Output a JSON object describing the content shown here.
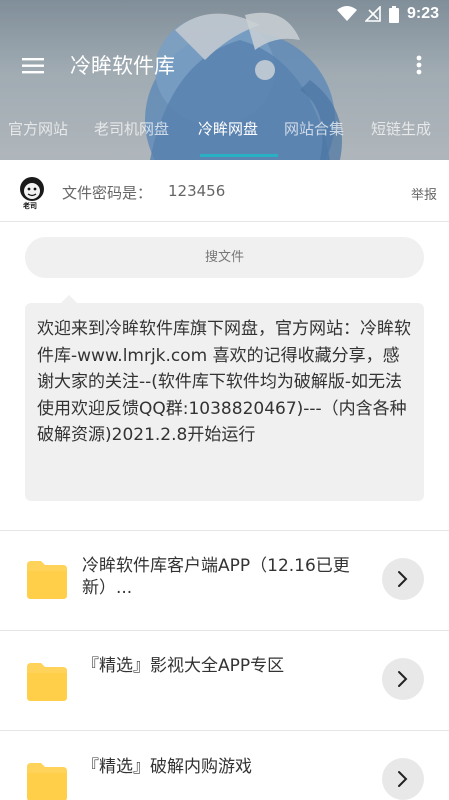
{
  "status_bar": {
    "time": "9:23"
  },
  "toolbar": {
    "title": "冷眸软件库"
  },
  "tabs": [
    {
      "label": "官方网站"
    },
    {
      "label": "老司机网盘"
    },
    {
      "label": "冷眸网盘"
    },
    {
      "label": "网站合集"
    },
    {
      "label": "短链生成"
    }
  ],
  "info": {
    "avatar_text": "老司",
    "password_label": "文件密码是：",
    "password_value": "123456",
    "report_label": "举报"
  },
  "search": {
    "label": "搜文件"
  },
  "notice": {
    "text": "欢迎来到冷眸软件库旗下网盘，官方网站：冷眸软件库-www.lmrjk.com 喜欢的记得收藏分享，感谢大家的关注--(软件库下软件均为破解版-如无法使用欢迎反馈QQ群:1038820467)---（内含各种破解资源)2021.2.8开始运行"
  },
  "files": [
    {
      "name": "冷眸软件库客户端APP（12.16已更新）..."
    },
    {
      "name": "『精选』影视大全APP专区"
    },
    {
      "name": "『精选』破解内购游戏"
    }
  ],
  "colors": {
    "accent": "#2ab0c4",
    "folder": "#ffd35a",
    "surface": "#f0f0f0"
  }
}
